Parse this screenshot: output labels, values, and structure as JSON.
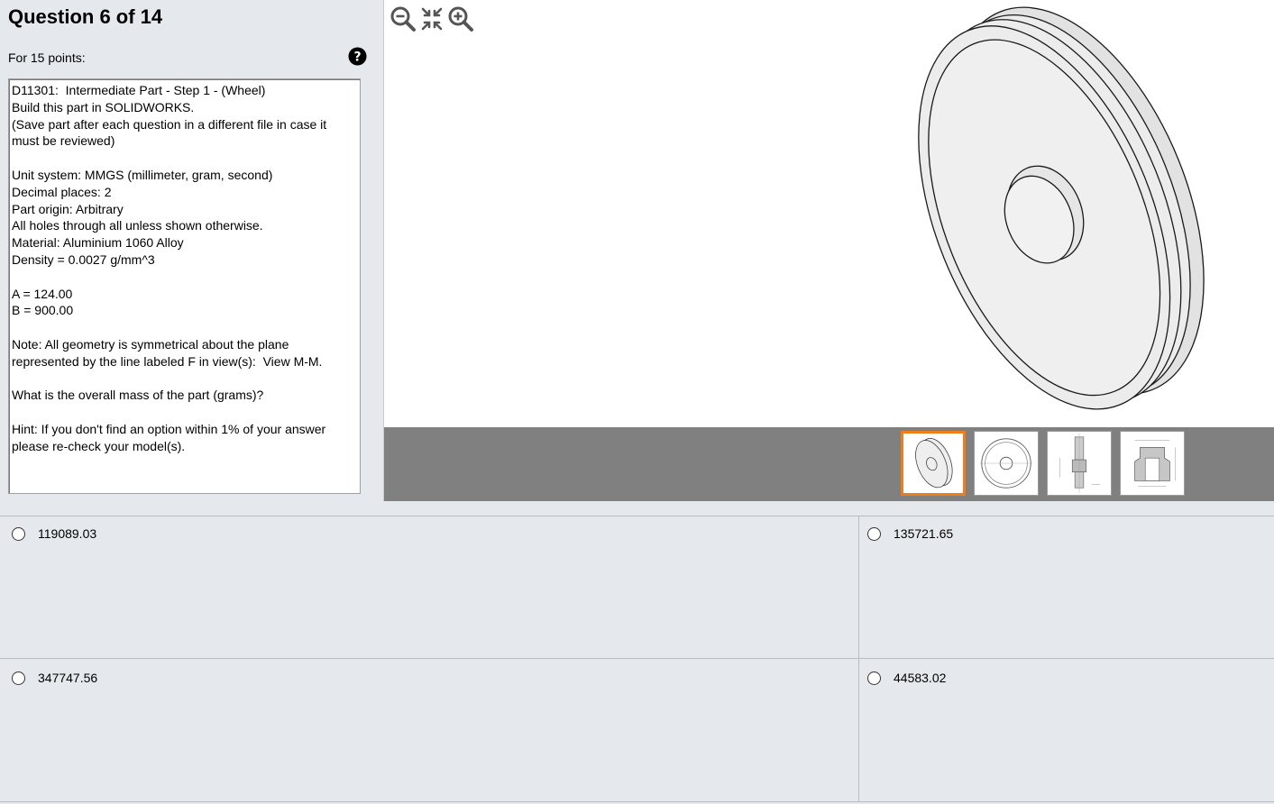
{
  "header": {
    "title": "Question 6 of 14",
    "points": "For 15 points:",
    "help_icon": "question-circle-icon"
  },
  "question": {
    "lines": [
      "D11301:  Intermediate Part - Step 1 - (Wheel)",
      "Build this part in SOLIDWORKS.",
      "(Save part after each question in a different file in case it",
      "must be reviewed)",
      "",
      "Unit system: MMGS (millimeter, gram, second)",
      "Decimal places: 2",
      "Part origin: Arbitrary",
      "All holes through all unless shown otherwise.",
      "Material: Aluminium 1060 Alloy",
      "Density = 0.0027 g/mm^3",
      "",
      "A = 124.00",
      "B = 900.00",
      "",
      "Note: All geometry is symmetrical about the plane",
      "represented by the line labeled F in view(s):  View M-M.",
      "",
      "What is the overall mass of the part (grams)?",
      "",
      "Hint: If you don't find an option within 1% of your answer",
      "please re-check your model(s)."
    ]
  },
  "viewer": {
    "tools": [
      {
        "icon": "zoom-out-icon"
      },
      {
        "icon": "fit-to-window-icon"
      },
      {
        "icon": "zoom-in-icon"
      }
    ],
    "thumbnails": [
      {
        "name": "isometric-view",
        "selected": true
      },
      {
        "name": "front-view",
        "selected": false
      },
      {
        "name": "side-section-view",
        "selected": false
      },
      {
        "name": "detail-section-view",
        "selected": false
      }
    ],
    "selected_color": "#ef7d1a"
  },
  "answers": {
    "options": [
      {
        "value": "119089.03"
      },
      {
        "value": "135721.65"
      },
      {
        "value": "347747.56"
      },
      {
        "value": "44583.02"
      }
    ]
  }
}
